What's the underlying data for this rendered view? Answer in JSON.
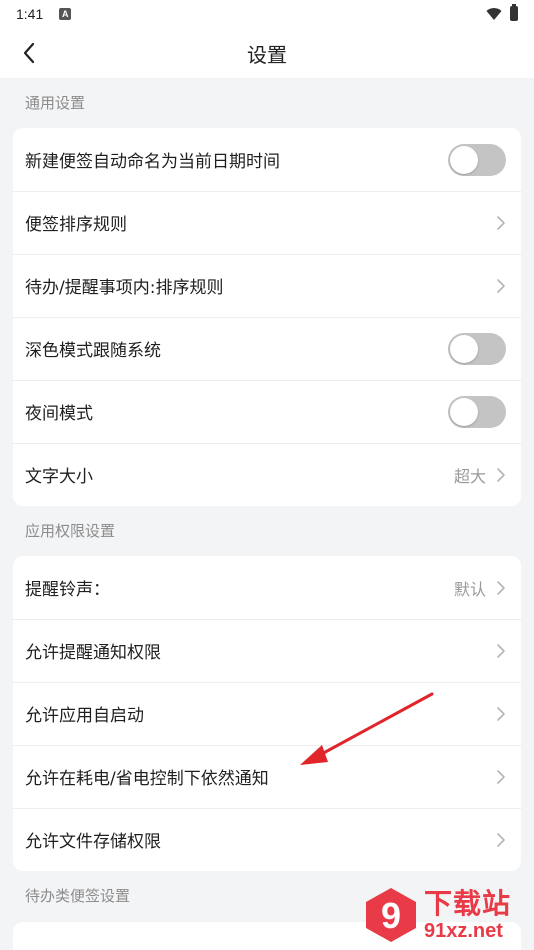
{
  "status_bar": {
    "time": "1:41",
    "notification_badge": "A",
    "icons": [
      "wifi-icon",
      "battery-icon"
    ]
  },
  "app_bar": {
    "title": "设置",
    "back_icon": "chevron-left-icon"
  },
  "sections": [
    {
      "header": "通用设置",
      "rows": [
        {
          "label": "新建便签自动命名为当前日期时间",
          "type": "toggle",
          "on": false
        },
        {
          "label": "便签排序规则",
          "type": "link"
        },
        {
          "label": "待办/提醒事项内:排序规则",
          "type": "link"
        },
        {
          "label": "深色模式跟随系统",
          "type": "toggle",
          "on": false
        },
        {
          "label": "夜间模式",
          "type": "toggle",
          "on": false
        },
        {
          "label": "文字大小",
          "type": "link",
          "value": "超大"
        }
      ]
    },
    {
      "header": "应用权限设置",
      "rows": [
        {
          "label": "提醒铃声：",
          "type": "link",
          "value": "默认"
        },
        {
          "label": "允许提醒通知权限",
          "type": "link"
        },
        {
          "label": "允许应用自启动",
          "type": "link"
        },
        {
          "label": "允许在耗电/省电控制下依然通知",
          "type": "link"
        },
        {
          "label": "允许文件存储权限",
          "type": "link"
        }
      ]
    },
    {
      "header": "待办类便签设置",
      "rows": []
    }
  ],
  "colors": {
    "background": "#f3f4f6",
    "card": "#ffffff",
    "toggle_off": "#c4c4c4",
    "annotation_arrow": "#e0262b",
    "watermark": "#e83b47"
  },
  "watermark": {
    "logo_text": "9",
    "cn_text": "下载站",
    "url_text": "91xz.net"
  }
}
